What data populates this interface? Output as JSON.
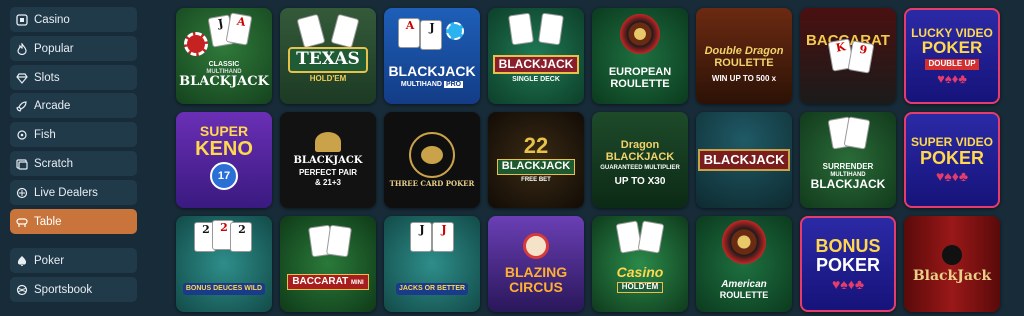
{
  "sidebar": {
    "items": [
      {
        "label": "Casino",
        "icon": "casino-icon",
        "active": false
      },
      {
        "label": "Popular",
        "icon": "flame-icon",
        "active": false
      },
      {
        "label": "Slots",
        "icon": "diamond-icon",
        "active": false
      },
      {
        "label": "Arcade",
        "icon": "rocket-icon",
        "active": false
      },
      {
        "label": "Fish",
        "icon": "fish-icon",
        "active": false
      },
      {
        "label": "Scratch",
        "icon": "scratch-icon",
        "active": false
      },
      {
        "label": "Live Dealers",
        "icon": "live-icon",
        "active": false
      },
      {
        "label": "Table",
        "icon": "table-icon",
        "active": true
      },
      {
        "label": "Poker",
        "icon": "poker-chip-icon",
        "active": false
      },
      {
        "label": "Sportsbook",
        "icon": "ball-icon",
        "active": false
      }
    ],
    "active_color": "#c9743a"
  },
  "games": [
    {
      "line1": "CLASSIC",
      "line2": "BLACKJACK",
      "line3": "MULTIHAND"
    },
    {
      "line1": "TEXAS",
      "line2": "HOLD'EM",
      "line3": ""
    },
    {
      "line1": "BLACKJACK",
      "line2": "MULTIHAND",
      "line3": "PRO"
    },
    {
      "line1": "BLACKJACK",
      "line2": "SINGLE DECK",
      "line3": ""
    },
    {
      "line1": "EUROPEAN",
      "line2": "ROULETTE",
      "line3": ""
    },
    {
      "line1": "Double Dragon",
      "line2": "ROULETTE",
      "line3": "WIN UP TO 500 x"
    },
    {
      "line1": "BACCARAT",
      "line2": "",
      "line3": ""
    },
    {
      "line1": "LUCKY VIDEO",
      "line2": "POKER",
      "line3": "DOUBLE UP"
    },
    {
      "line1": "SUPER",
      "line2": "KENO",
      "line3": "17"
    },
    {
      "line1": "BLACKJACK",
      "line2": "PERFECT PAIR",
      "line3": "& 21+3"
    },
    {
      "line1": "THREE CARD POKER",
      "line2": "",
      "line3": ""
    },
    {
      "line1": "BLACKJACK",
      "line2": "FREE BET",
      "line3": ""
    },
    {
      "line1": "Dragon BLACKJACK",
      "line2": "GUARANTEED MULTIPLIER",
      "line3": "UP TO X30"
    },
    {
      "line1": "BLACKJACK",
      "line2": "",
      "line3": ""
    },
    {
      "line1": "SURRENDER",
      "line2": "BLACKJACK",
      "line3": "MULTIHAND"
    },
    {
      "line1": "SUPER VIDEO",
      "line2": "POKER",
      "line3": ""
    },
    {
      "line1": "BONUS DEUCES WILD",
      "line2": "",
      "line3": ""
    },
    {
      "line1": "BACCARAT",
      "line2": "MINI",
      "line3": ""
    },
    {
      "line1": "JACKS OR BETTER",
      "line2": "",
      "line3": ""
    },
    {
      "line1": "BLAZING",
      "line2": "CIRCUS",
      "line3": ""
    },
    {
      "line1": "Casino",
      "line2": "HOLD'EM",
      "line3": ""
    },
    {
      "line1": "American",
      "line2": "ROULETTE",
      "line3": ""
    },
    {
      "line1": "BONUS",
      "line2": "POKER",
      "line3": ""
    },
    {
      "line1": "BlackJack",
      "line2": "",
      "line3": ""
    }
  ]
}
